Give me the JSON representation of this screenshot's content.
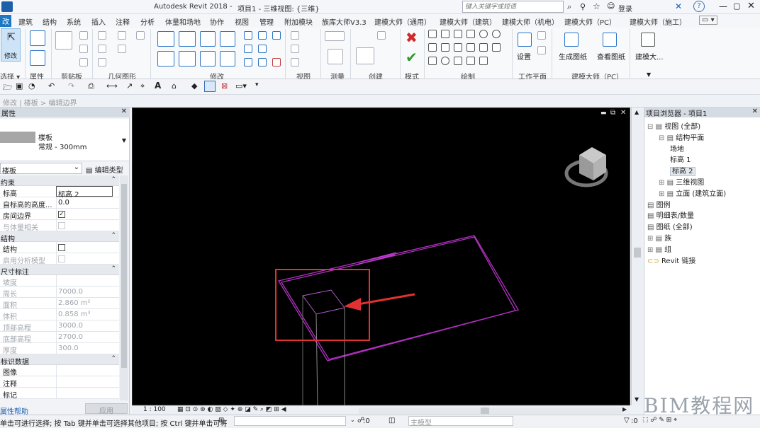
{
  "titlebar": {
    "app": "Autodesk Revit 2018 -",
    "doc": "项目1 - 三维视图: {三维}",
    "search_placeholder": "键入关键字或短语",
    "login": "登录"
  },
  "tabs": [
    "建筑",
    "结构",
    "系统",
    "插入",
    "注释",
    "分析",
    "体量和场地",
    "协作",
    "视图",
    "管理",
    "附加模块",
    "族库大师V3.3",
    "建模大师（通用）",
    "建模大师（建筑）",
    "建模大师（机电）",
    "建模大师（PC）",
    "建模大师（施工）"
  ],
  "ribbon": {
    "modify_label": "修改",
    "groups": [
      "选择 ▾",
      "属性",
      "剪贴板",
      "几何图形",
      "修改",
      "视图",
      "测量",
      "创建",
      "模式",
      "绘制",
      "工作平面",
      "建模大师（PC）"
    ],
    "setting_label": "设置",
    "gen_label": "生成图纸",
    "view_label": "查看图纸",
    "bim_label": "建模大..."
  },
  "pathbar": "修改 | 楼板 > 编辑边界",
  "properties": {
    "title": "属性",
    "family_name": "楼板",
    "type_name": "常规 - 300mm",
    "selector": "楼板",
    "edit_type": "编辑类型",
    "help": "属性帮助",
    "apply": "应用",
    "sections": [
      {
        "name": "约束",
        "rows": [
          {
            "k": "标高",
            "v": "标高 2"
          },
          {
            "k": "自标高的高度...",
            "v": "0.0"
          },
          {
            "k": "房间边界",
            "v": "checked"
          },
          {
            "k": "与体量相关",
            "v": "",
            "dim": true
          }
        ]
      },
      {
        "name": "结构",
        "rows": [
          {
            "k": "结构",
            "v": "unchecked"
          },
          {
            "k": "启用分析模型",
            "v": "",
            "dim": true
          }
        ]
      },
      {
        "name": "尺寸标注",
        "rows": [
          {
            "k": "坡度",
            "v": "",
            "dim": true
          },
          {
            "k": "周长",
            "v": "7000.0",
            "dim": true
          },
          {
            "k": "面积",
            "v": "2.860 m²",
            "dim": true
          },
          {
            "k": "体积",
            "v": "0.858 m³",
            "dim": true
          },
          {
            "k": "顶部高程",
            "v": "3000.0",
            "dim": true
          },
          {
            "k": "底部高程",
            "v": "2700.0",
            "dim": true
          },
          {
            "k": "厚度",
            "v": "300.0",
            "dim": true
          }
        ]
      },
      {
        "name": "标识数据",
        "rows": [
          {
            "k": "图像",
            "v": ""
          },
          {
            "k": "注释",
            "v": ""
          },
          {
            "k": "标记",
            "v": ""
          }
        ]
      }
    ]
  },
  "viewport": {
    "scale": "1 : 100"
  },
  "browser": {
    "title": "项目浏览器 - 项目1",
    "items": [
      {
        "t": "视图 (全部)",
        "lvl": 0,
        "exp": "⊟"
      },
      {
        "t": "结构平面",
        "lvl": 1,
        "exp": "⊟"
      },
      {
        "t": "场地",
        "lvl": 2
      },
      {
        "t": "标高 1",
        "lvl": 2
      },
      {
        "t": "标高 2",
        "lvl": 2,
        "sel": true
      },
      {
        "t": "三维视图",
        "lvl": 1,
        "exp": "⊞"
      },
      {
        "t": "立面 (建筑立面)",
        "lvl": 1,
        "exp": "⊞"
      },
      {
        "t": "图例",
        "lvl": 0
      },
      {
        "t": "明细表/数量",
        "lvl": 0
      },
      {
        "t": "图纸 (全部)",
        "lvl": 0
      },
      {
        "t": "族",
        "lvl": 0,
        "exp": "⊞"
      },
      {
        "t": "组",
        "lvl": 0,
        "exp": "⊞"
      },
      {
        "t": "Revit 链接",
        "lvl": 0,
        "link": true
      }
    ]
  },
  "status": {
    "text": "单击可进行选择; 按 Tab 键并单击可选择其他项目; 按 Ctrl 键并单击可将",
    "zero1": ":0",
    "model": "主模型",
    "zero2": ":0"
  },
  "watermark": "BIM教程网"
}
